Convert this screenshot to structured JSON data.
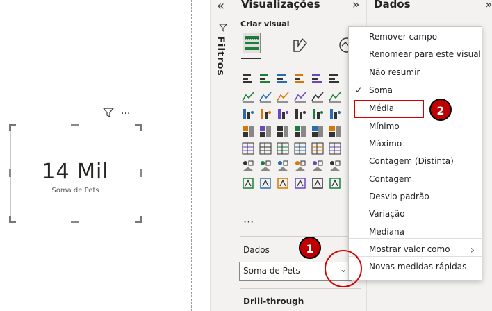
{
  "report_canvas": {
    "card": {
      "value": "14 Mil",
      "label": "Soma de Pets"
    },
    "toolbar": {
      "more_text": "···"
    }
  },
  "filters_pane": {
    "collapse_glyph": "«",
    "label": "Filtros"
  },
  "visualizations_pane": {
    "title": "Visualizações",
    "collapse_glyph": "»",
    "build_visual_label": "Criar visual",
    "more_visuals_text": "···",
    "data_section_label": "Dados",
    "field_well_value": "Soma de Pets",
    "dropdown_glyph": "⌄",
    "drillthrough_label": "Drill-through"
  },
  "data_pane": {
    "title": "Dados",
    "expand_glyph": "»"
  },
  "context_menu": {
    "items": [
      {
        "label": "Remover campo"
      },
      {
        "label": "Renomear para este visual"
      },
      {
        "label": "Não resumir"
      },
      {
        "label": "Soma",
        "checked": true
      },
      {
        "label": "Média",
        "highlighted": true
      },
      {
        "label": "Mínimo"
      },
      {
        "label": "Máximo"
      },
      {
        "label": "Contagem (Distinta)"
      },
      {
        "label": "Contagem"
      },
      {
        "label": "Desvio padrão"
      },
      {
        "label": "Variação"
      },
      {
        "label": "Mediana"
      },
      {
        "label": "Mostrar valor como",
        "submenu": true
      },
      {
        "label": "Novas medidas rápidas"
      }
    ],
    "check_glyph": "✓",
    "submenu_glyph": "›"
  },
  "annotations": {
    "step1": "1",
    "step2": "2",
    "accent_color": "#c00000"
  },
  "visual_icons": [
    "stacked-bar-chart-icon",
    "stacked-column-chart-icon",
    "clustered-bar-chart-icon",
    "clustered-column-chart-icon",
    "100-stacked-bar-chart-icon",
    "100-stacked-column-chart-icon",
    "line-chart-icon",
    "area-chart-icon",
    "stacked-area-chart-icon",
    "line-stacked-column-icon",
    "line-clustered-column-icon",
    "ribbon-chart-icon",
    "waterfall-chart-icon",
    "funnel-chart-icon",
    "funnel-icon",
    "scatter-chart-icon",
    "pie-chart-icon",
    "donut-chart-icon",
    "treemap-icon",
    "map-icon",
    "filled-map-icon",
    "azure-map-icon",
    "gauge-icon",
    "card-icon",
    "multirow-card-icon",
    "kpi-icon",
    "slicer-icon",
    "table-icon",
    "matrix-icon",
    "r-visual-icon",
    "python-visual-icon",
    "key-influencers-icon",
    "decomposition-tree-icon",
    "qa-icon",
    "narrative-icon",
    "paginated-report-icon",
    "metrics-icon",
    "power-apps-icon",
    "power-automate-icon",
    "diamond-icon",
    "scorecard-icon",
    "arcgis-icon"
  ]
}
